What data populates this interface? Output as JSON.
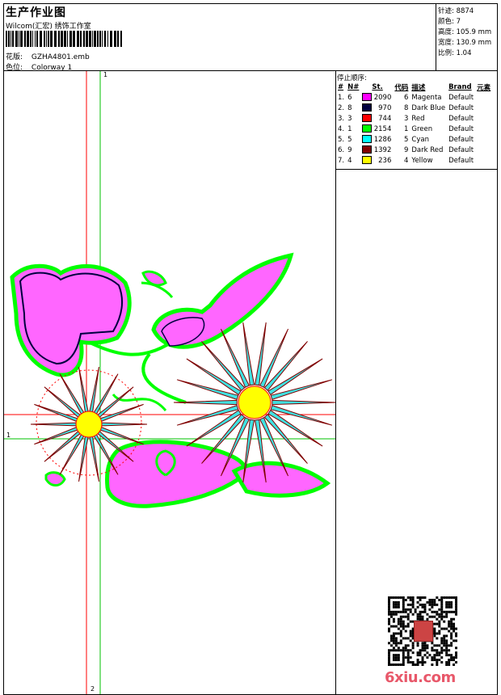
{
  "header": {
    "title": "生产作业图",
    "subtitle": "Wilcom(汇宏) 绣饰工作室",
    "design_label": "花版:",
    "design_value": "GZHA4801.emb",
    "colorway_label": "色位:",
    "colorway_value": "Colorway 1"
  },
  "stats": {
    "stitches": "针迹: 8874",
    "colors": "颜色: 7",
    "height": "高度: 105.9 mm",
    "width": "宽度: 130.9 mm",
    "scale": "比例: 1.04"
  },
  "sequence": {
    "title": "停止顺序:",
    "headers": [
      "#",
      "N#",
      "St.",
      "代码",
      "描述",
      "Brand",
      "元素"
    ],
    "rows": [
      {
        "idx": "1.",
        "n": "6",
        "color": "#ff00ff",
        "st": "2090",
        "code": "6",
        "desc": "Magenta",
        "brand": "Default"
      },
      {
        "idx": "2.",
        "n": "8",
        "color": "#000040",
        "st": "970",
        "code": "8",
        "desc": "Dark Blue",
        "brand": "Default"
      },
      {
        "idx": "3.",
        "n": "3",
        "color": "#ff0000",
        "st": "744",
        "code": "3",
        "desc": "Red",
        "brand": "Default"
      },
      {
        "idx": "4.",
        "n": "1",
        "color": "#00ff00",
        "st": "2154",
        "code": "1",
        "desc": "Green",
        "brand": "Default"
      },
      {
        "idx": "5.",
        "n": "5",
        "color": "#00ffff",
        "st": "1286",
        "code": "5",
        "desc": "Cyan",
        "brand": "Default"
      },
      {
        "idx": "6.",
        "n": "9",
        "color": "#800000",
        "st": "1392",
        "code": "9",
        "desc": "Dark Red",
        "brand": "Default"
      },
      {
        "idx": "7.",
        "n": "4",
        "color": "#ffff00",
        "st": "236",
        "code": "4",
        "desc": "Yellow",
        "brand": "Default"
      }
    ]
  },
  "canvas": {
    "axis_top": "1",
    "axis_left": "1",
    "axis_bottom": "2",
    "colors": {
      "guide_red": "#ff0000",
      "guide_green": "#00c000"
    }
  },
  "watermark": "6xiu.com"
}
